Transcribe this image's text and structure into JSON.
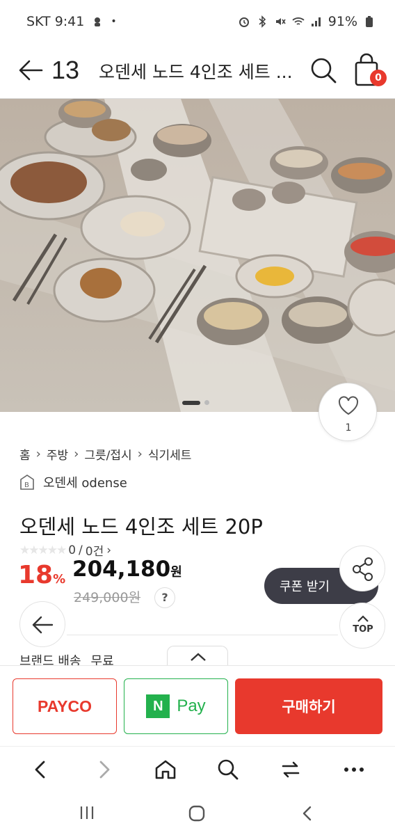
{
  "status_bar": {
    "carrier_time": "SKT 9:41",
    "battery": "91%"
  },
  "header": {
    "logo": "13",
    "title": "오덴세 노드 4인조 세트 ...",
    "cart_count": "0"
  },
  "like": {
    "count": "1"
  },
  "breadcrumb": [
    "홈",
    "주방",
    "그릇/접시",
    "식기세트"
  ],
  "brand": {
    "name": "오덴세 odense"
  },
  "product": {
    "title": "오덴세 노드 4인조 세트 20P",
    "rating": "0",
    "review_sep": "/",
    "review_count": "0건",
    "discount": "18",
    "discount_unit": "%",
    "price": "204,180",
    "price_unit": "원",
    "original_price": "249,000원",
    "help": "?"
  },
  "coupon": {
    "label": "쿠폰 받기"
  },
  "top_button": {
    "label": "TOP"
  },
  "shipping": {
    "text1": "브랜드 배송",
    "text2": "무료"
  },
  "actions": {
    "payco": "PAYCO",
    "npay_n": "N",
    "npay": "Pay",
    "buy": "구매하기"
  },
  "colors": {
    "accent": "#e8392d",
    "npay": "#23b14d",
    "coupon_bg": "#3d3d47"
  }
}
